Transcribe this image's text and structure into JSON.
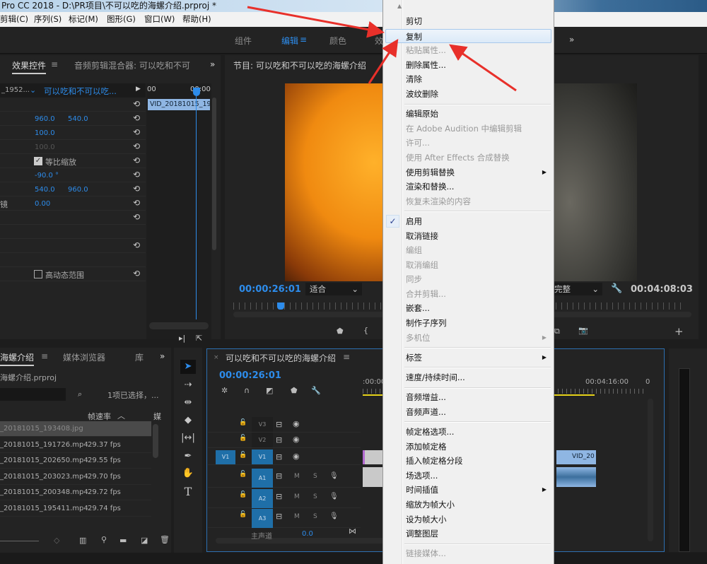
{
  "window": {
    "title": "Pro CC 2018 - D:\\PR项目\\不可以吃的海螺介绍.prproj *"
  },
  "menubar": [
    "剪辑(C)",
    "序列(S)",
    "标记(M)",
    "图形(G)",
    "窗口(W)",
    "帮助(H)"
  ],
  "workspaces": {
    "items": [
      "组件",
      "编辑",
      "颜色",
      "效"
    ],
    "active": "编辑",
    "more": "»"
  },
  "effect_controls": {
    "tabs": [
      "效果控件",
      "音频剪辑混合器: 可以吃和不可"
    ],
    "more": "»",
    "source_clip": "_1952...",
    "sequence": "可以吃和不可以吃...",
    "ruler_start": "00",
    "ruler_end": "00:00",
    "clip_label": "VID_20181015_195",
    "rows": {
      "position_x": "960.0",
      "position_y": "540.0",
      "scale": "100.0",
      "scale_width": "100.0",
      "uniform_scale": "等比缩放",
      "rotation": "-90.0 °",
      "anchor_x": "540.0",
      "anchor_y": "960.0",
      "flicker_label": "镜",
      "flicker": "0.00",
      "hdr": "高动态范围"
    },
    "uniform_scale_checked": true,
    "hdr_checked": false
  },
  "program": {
    "title": "节目: 可以吃和不可以吃的海螺介绍",
    "timecode": "00:00:26:01",
    "fit": "适合",
    "quality": "完整",
    "duration": "00:04:08:03"
  },
  "project": {
    "tabs": [
      "海螺介绍",
      "媒体浏览器",
      "库"
    ],
    "more": "»",
    "file": "海螺介绍.prproj",
    "selection": "1项已选择，...",
    "columns": [
      "帧速率",
      "媒"
    ],
    "items": [
      {
        "name": "_20181015_193408.jpg",
        "fps": ""
      },
      {
        "name": "_20181015_191726.mp4",
        "fps": "29.37 fps"
      },
      {
        "name": "_20181015_202650.mp4",
        "fps": "29.55 fps"
      },
      {
        "name": "_20181015_203023.mp4",
        "fps": "29.70 fps"
      },
      {
        "name": "_20181015_200348.mp4",
        "fps": "29.72 fps"
      },
      {
        "name": "_20181015_195411.mp4",
        "fps": "29.74 fps"
      }
    ]
  },
  "timeline": {
    "title": "可以吃和不可以吃的海螺介绍",
    "timecode": "00:00:26:01",
    "ruler": [
      ":00:00",
      "00:04:16:00",
      "0"
    ],
    "source_patch": "V1",
    "tracks": [
      {
        "name": "V3",
        "type": "video"
      },
      {
        "name": "V2",
        "type": "video"
      },
      {
        "name": "V1",
        "type": "video"
      },
      {
        "name": "A1",
        "type": "audio"
      },
      {
        "name": "A2",
        "type": "audio"
      },
      {
        "name": "A3",
        "type": "audio"
      }
    ],
    "master": "主声道",
    "master_value": "0.0",
    "clip_label": "VID_20",
    "mute": "M",
    "solo": "S"
  },
  "context_menu": [
    {
      "label": "剪切"
    },
    {
      "label": "复制",
      "highlighted": true
    },
    {
      "label": "粘贴属性...",
      "disabled": true
    },
    {
      "label": "删除属性..."
    },
    {
      "label": "清除"
    },
    {
      "label": "波纹删除"
    },
    {
      "separator": true
    },
    {
      "label": "编辑原始"
    },
    {
      "label": "在 Adobe Audition 中编辑剪辑",
      "disabled": true
    },
    {
      "label": "许可...",
      "disabled": true
    },
    {
      "label": "使用 After Effects 合成替换",
      "disabled": true
    },
    {
      "label": "使用剪辑替换",
      "submenu": true
    },
    {
      "label": "渲染和替换..."
    },
    {
      "label": "恢复未渲染的内容",
      "disabled": true
    },
    {
      "separator": true
    },
    {
      "label": "启用",
      "checked": true
    },
    {
      "label": "取消链接"
    },
    {
      "label": "编组",
      "disabled": true
    },
    {
      "label": "取消编组",
      "disabled": true
    },
    {
      "label": "同步",
      "disabled": true
    },
    {
      "label": "合并剪辑...",
      "disabled": true
    },
    {
      "label": "嵌套..."
    },
    {
      "label": "制作子序列"
    },
    {
      "label": "多机位",
      "disabled": true,
      "submenu": true
    },
    {
      "separator": true
    },
    {
      "label": "标签",
      "submenu": true
    },
    {
      "separator": true
    },
    {
      "label": "速度/持续时间..."
    },
    {
      "separator": true
    },
    {
      "label": "音频增益..."
    },
    {
      "label": "音频声道..."
    },
    {
      "separator": true
    },
    {
      "label": "帧定格选项..."
    },
    {
      "label": "添加帧定格"
    },
    {
      "label": "插入帧定格分段"
    },
    {
      "label": "场选项..."
    },
    {
      "label": "时间插值",
      "submenu": true
    },
    {
      "label": "缩放为帧大小"
    },
    {
      "label": "设为帧大小"
    },
    {
      "label": "调整图层"
    },
    {
      "separator": true
    },
    {
      "label": "链接媒体...",
      "disabled": true
    }
  ],
  "colors": {
    "accent": "#2d8ceb",
    "menu_bg": "#f0f0f0",
    "arrow": "#e8302a",
    "panel": "#232323",
    "clip": "#8fb6e3"
  }
}
